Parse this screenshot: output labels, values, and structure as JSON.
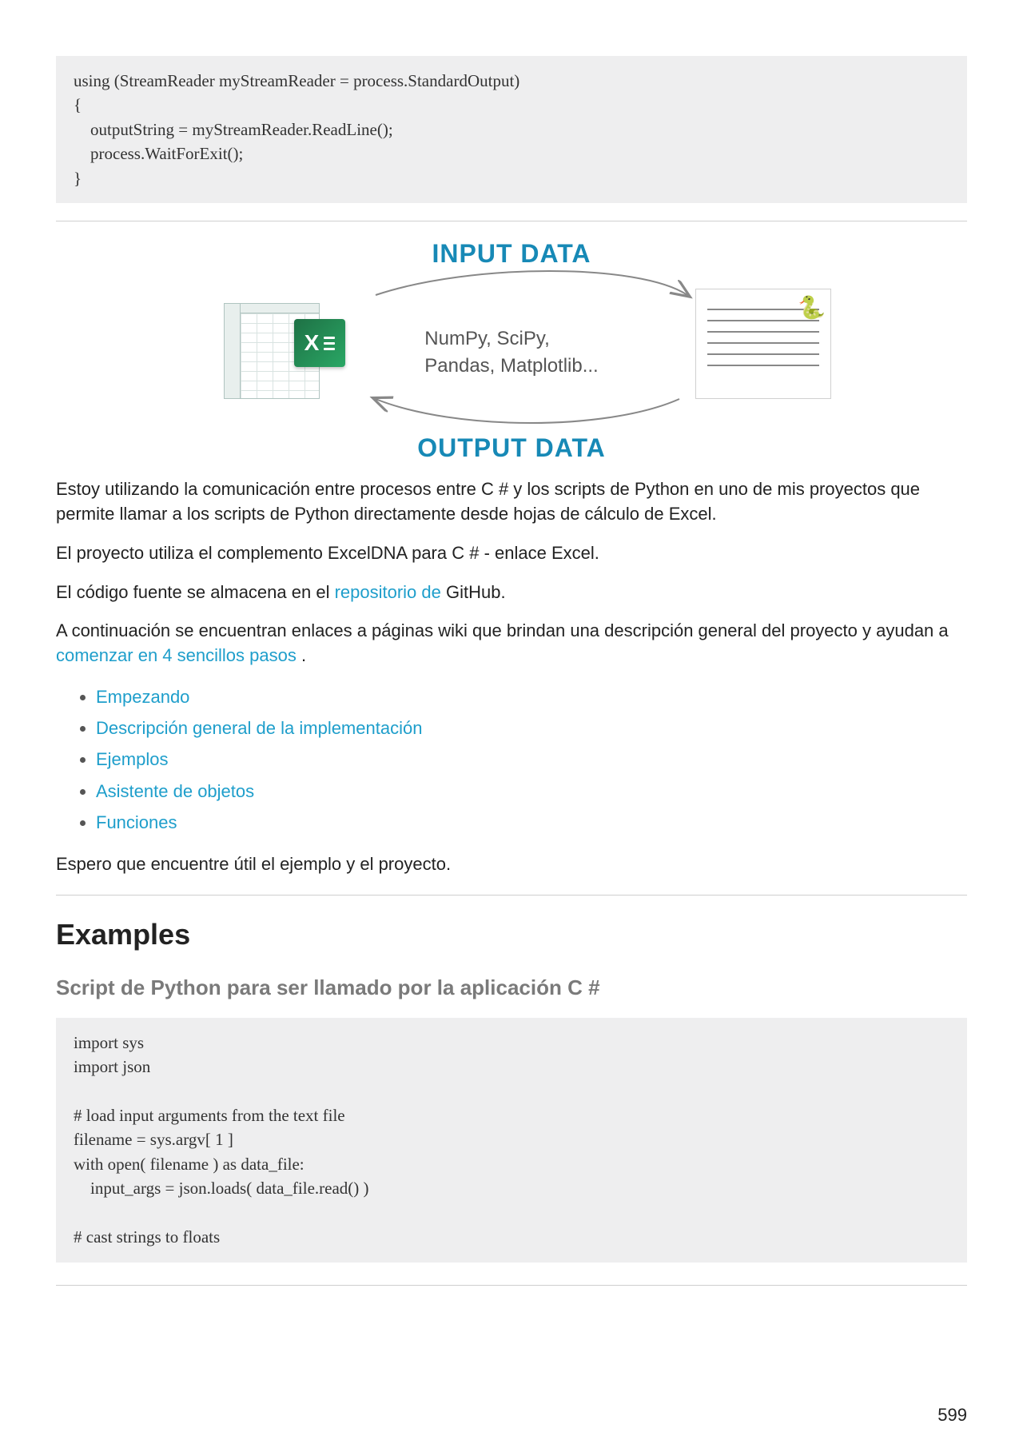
{
  "code_block_1": "using (StreamReader myStreamReader = process.StandardOutput)\n{\n    outputString = myStreamReader.ReadLine();\n    process.WaitForExit();\n}",
  "diagram": {
    "input_label": "INPUT DATA",
    "output_label": "OUTPUT DATA",
    "libs_line1": "NumPy, SciPy,",
    "libs_line2": "Pandas, Matplotlib...",
    "excel_badge": "X",
    "python_emoji": "🐍"
  },
  "para1": "Estoy utilizando la comunicación entre procesos entre C # y los scripts de Python en uno de mis proyectos que permite llamar a los scripts de Python directamente desde hojas de cálculo de Excel.",
  "para2": "El proyecto utiliza el complemento ExcelDNA para C # - enlace Excel.",
  "para3_pre": "El código fuente se almacena en el ",
  "para3_link": "repositorio de",
  "para3_post": " GitHub.",
  "para4_pre": "A continuación se encuentran enlaces a páginas wiki que brindan una descripción general del proyecto y ayudan a ",
  "para4_link": "comenzar en 4 sencillos pasos",
  "para4_post": " .",
  "links": {
    "l1": "Empezando",
    "l2": "Descripción general de la implementación",
    "l3": "Ejemplos",
    "l4": "Asistente de objetos",
    "l5": "Funciones"
  },
  "para5": "Espero que encuentre útil el ejemplo y el proyecto.",
  "examples_heading": "Examples",
  "sub_heading": "Script de Python para ser llamado por la aplicación C #",
  "code_block_2": "import sys\nimport json\n\n# load input arguments from the text file\nfilename = sys.argv[ 1 ]\nwith open( filename ) as data_file:\n    input_args = json.loads( data_file.read() )\n\n# cast strings to floats",
  "page_number": "599"
}
